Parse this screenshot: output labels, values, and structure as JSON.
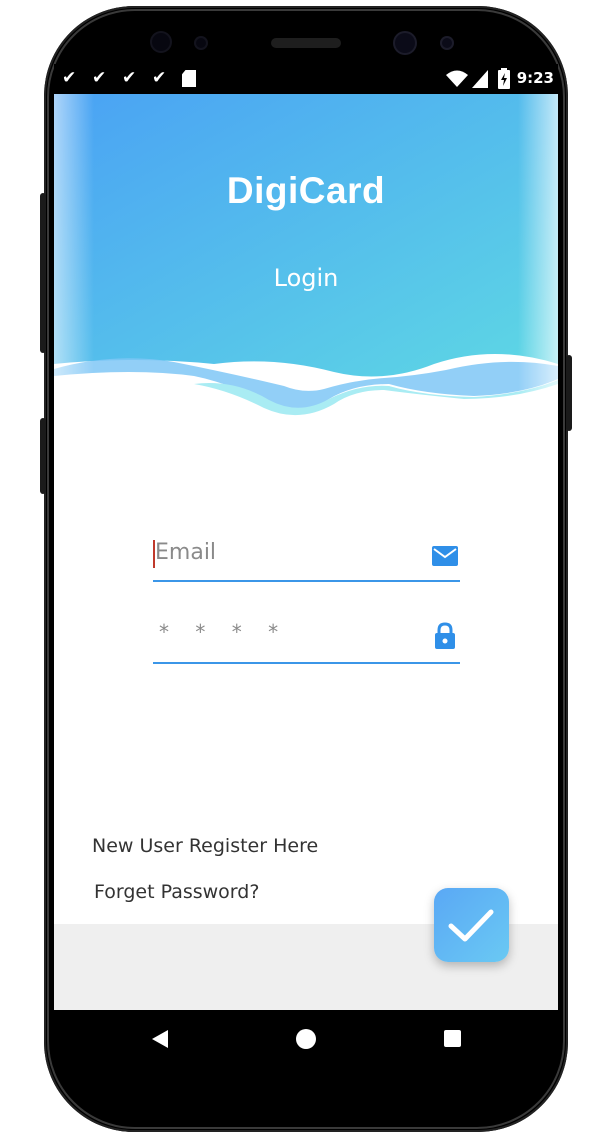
{
  "status_bar": {
    "notification_icons": [
      "check-icon",
      "check-icon",
      "check-icon",
      "check-icon",
      "sd-card-icon"
    ],
    "check_glyph": "✔",
    "time": "9:23",
    "system_icons": [
      "wifi-icon",
      "signal-icon",
      "battery-charging-icon"
    ]
  },
  "header": {
    "app_title": "DigiCard",
    "screen_title": "Login",
    "gradient": [
      "#4aa2f4",
      "#5ed8e4"
    ],
    "wave_colors": [
      "#7fc7f6",
      "#a9ecf3"
    ]
  },
  "form": {
    "email": {
      "placeholder": "Email",
      "value": "",
      "icon": "mail-icon"
    },
    "password": {
      "mask": "* * * *",
      "value": "",
      "icon": "lock-icon"
    },
    "underline_color": "#3b96e8"
  },
  "links": {
    "register": "New User Register Here",
    "forgot": "Forget Password?"
  },
  "submit": {
    "icon": "check-icon",
    "colors": [
      "#5aa8f5",
      "#6ac9f3"
    ]
  },
  "nav_bar": {
    "buttons": [
      "back-icon",
      "home-icon",
      "recent-apps-icon"
    ]
  }
}
